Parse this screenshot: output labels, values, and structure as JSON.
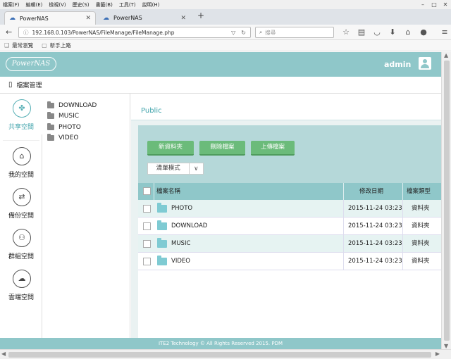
{
  "browser": {
    "menu": [
      "檔案(F)",
      "編輯(E)",
      "檢視(V)",
      "歷史(S)",
      "書籤(B)",
      "工具(T)",
      "說明(H)"
    ],
    "tabs": [
      {
        "label": "PowerNAS",
        "active": true
      },
      {
        "label": "PowerNAS",
        "active": false
      }
    ],
    "url": "192.168.0.103/PowerNAS/FileManage/FileManage.php",
    "search_placeholder": "搜尋",
    "bookmarks": [
      "最常瀏覽",
      "新手上路"
    ]
  },
  "app": {
    "logo": "PowerNAS",
    "user": "admin",
    "page_title": "檔案管理"
  },
  "rail": [
    {
      "label": "共享空間",
      "icon": "share-icon",
      "active": true
    },
    {
      "label": "我的空間",
      "icon": "home-icon",
      "active": false
    },
    {
      "label": "備份空間",
      "icon": "backup-icon",
      "active": false
    },
    {
      "label": "群組空間",
      "icon": "group-icon",
      "active": false
    },
    {
      "label": "雲端空間",
      "icon": "cloud-icon",
      "active": false
    }
  ],
  "tree": [
    "DOWNLOAD",
    "MUSIC",
    "PHOTO",
    "VIDEO"
  ],
  "main": {
    "crumb": "Public",
    "buttons": {
      "new_folder": "新資料夾",
      "delete_file": "刪除檔案",
      "upload_file": "上傳檔案"
    },
    "view_mode": "清單模式",
    "columns": {
      "name": "檔案名稱",
      "modified": "修改日期",
      "type": "檔案類型"
    },
    "rows": [
      {
        "name": "PHOTO",
        "modified": "2015-11-24 03:23",
        "type": "資料夾"
      },
      {
        "name": "DOWNLOAD",
        "modified": "2015-11-24 03:23",
        "type": "資料夾"
      },
      {
        "name": "MUSIC",
        "modified": "2015-11-24 03:23",
        "type": "資料夾"
      },
      {
        "name": "VIDEO",
        "modified": "2015-11-24 03:23",
        "type": "資料夾"
      }
    ]
  },
  "footer": "ITE2 Technology © All Rights Reserved 2015. PDM",
  "colors": {
    "accent": "#8fc7c9",
    "green_button": "#6bbb7a",
    "active_text": "#3fa3ab"
  }
}
